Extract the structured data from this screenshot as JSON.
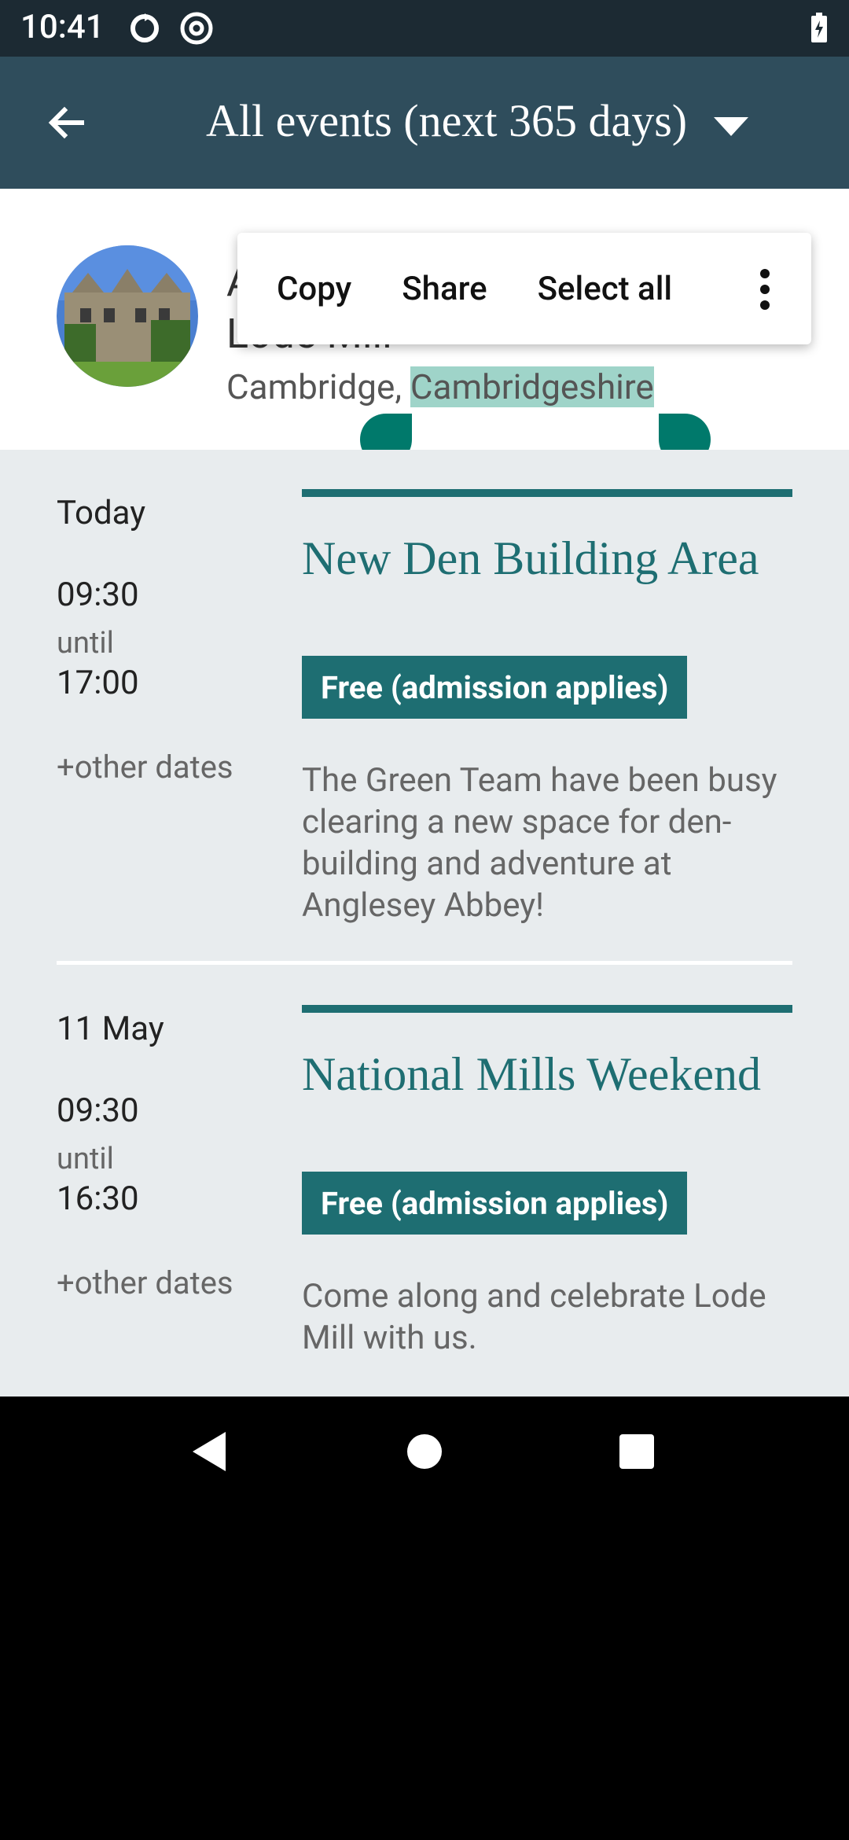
{
  "status_bar": {
    "time": "10:41"
  },
  "app_bar": {
    "title": "All events (next 365 days)"
  },
  "header": {
    "property_name": "Anglesey Abbey, Gardens and Lode Mill",
    "location_prefix": "Cambridge, ",
    "location_selected": "Cambridgeshire"
  },
  "context_menu": {
    "copy": "Copy",
    "share": "Share",
    "select_all": "Select all"
  },
  "events": [
    {
      "date": "Today",
      "start": "09:30",
      "until": "until",
      "end": "17:00",
      "other_dates": "+other dates",
      "title": "New Den Building Area",
      "price": "Free (admission applies)",
      "description": "The Green Team have been busy clearing a new space for den-building and adventure at Anglesey Abbey!"
    },
    {
      "date": "11 May",
      "start": "09:30",
      "until": "until",
      "end": "16:30",
      "other_dates": "+other dates",
      "title": "National Mills Weekend",
      "price": "Free (admission applies)",
      "description": "Come along and celebrate Lode Mill with us."
    }
  ],
  "colors": {
    "app_bar": "#2f4d5c",
    "accent": "#1e6e72",
    "selection": "#9fd4c9",
    "handle": "#00796b"
  }
}
